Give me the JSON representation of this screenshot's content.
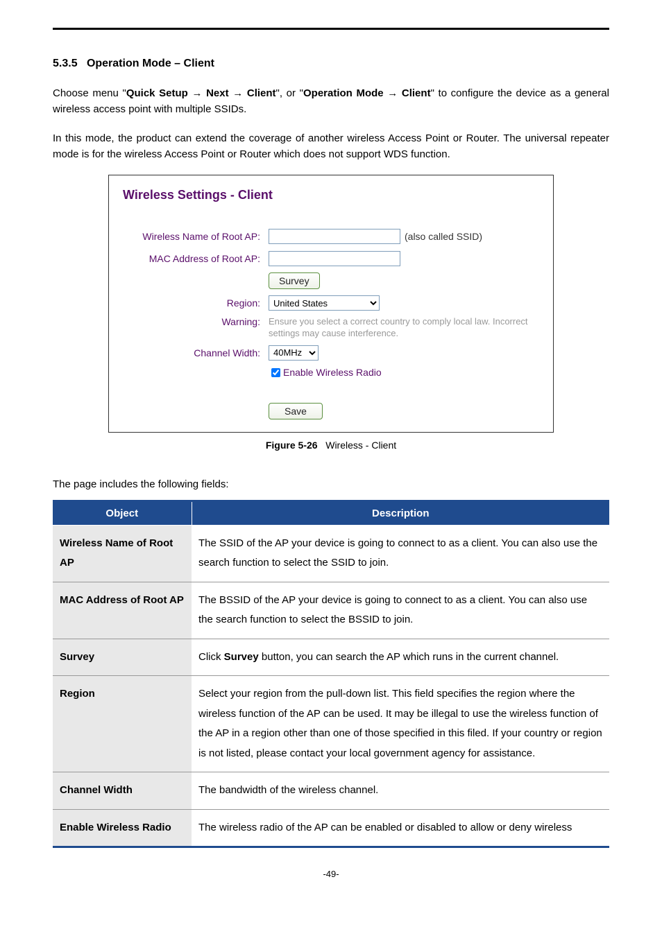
{
  "section": {
    "number": "5.3.5",
    "title": "Operation Mode – Client"
  },
  "paragraphs": {
    "p1_a": "Choose menu \"",
    "p1_b": "Quick Setup → Next → Client",
    "p1_c": "\", or \"",
    "p1_d": "Operation Mode → Client",
    "p1_e": "\" to configure the device as a general wireless access point with multiple SSIDs.",
    "p2": "In this mode, the product can extend the coverage of another wireless Access Point or Router. The universal repeater mode is for the wireless Access Point or Router which does not support WDS function."
  },
  "figure": {
    "heading": "Wireless Settings - Client",
    "labels": {
      "wireless_name": "Wireless Name of Root AP:",
      "mac": "MAC Address of Root AP:",
      "region": "Region:",
      "warning": "Warning:",
      "channel_width": "Channel Width:"
    },
    "values": {
      "after_ssid": "(also called SSID)",
      "survey_btn": "Survey",
      "region_selected": "United States",
      "warning_text": "Ensure you select a correct country to comply local law. Incorrect settings may cause interference.",
      "channel_width_selected": "40MHz",
      "enable_radio": "Enable Wireless Radio",
      "save_btn": "Save"
    },
    "caption_bold": "Figure 5-26",
    "caption_rest": "Wireless - Client"
  },
  "fields_intro": "The page includes the following fields:",
  "table": {
    "headers": {
      "object": "Object",
      "description": "Description"
    },
    "rows": [
      {
        "object": "Wireless Name of Root AP",
        "desc": "The SSID of the AP your device is going to connect to as a client. You can also use the search function to select the SSID to join."
      },
      {
        "object": "MAC Address of Root AP",
        "desc": "The BSSID of the AP your device is going to connect to as a client. You can also use the search function to select the BSSID to join."
      },
      {
        "object": "Survey",
        "desc_a": "Click ",
        "desc_bold": "Survey",
        "desc_b": " button, you can search the AP which runs in the current channel."
      },
      {
        "object": "Region",
        "desc": "Select your region from the pull-down list. This field specifies the region where the wireless function of the AP can be used. It may be illegal to use the wireless function of the AP in a region other than one of those specified in this filed. If your country or region is not listed, please contact your local government agency for assistance."
      },
      {
        "object": "Channel Width",
        "desc": "The bandwidth of the wireless channel."
      },
      {
        "object": "Enable Wireless Radio",
        "desc": "The wireless radio of the AP can be enabled or disabled to allow or deny wireless"
      }
    ]
  },
  "footer": "-49-"
}
